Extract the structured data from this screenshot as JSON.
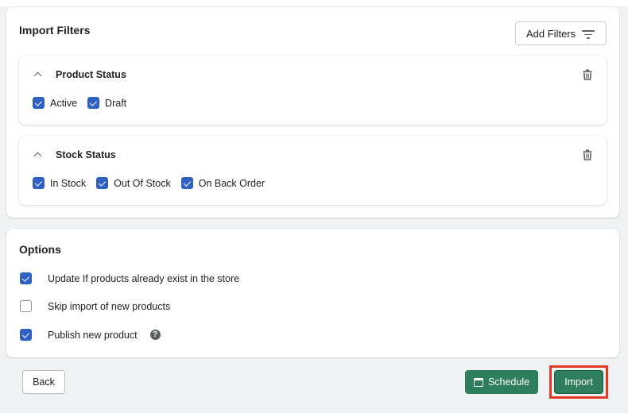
{
  "import_filters": {
    "title": "Import Filters",
    "add_filters_label": "Add Filters",
    "groups": [
      {
        "title": "Product Status",
        "expanded": true,
        "options": [
          {
            "label": "Active",
            "checked": true
          },
          {
            "label": "Draft",
            "checked": true
          }
        ]
      },
      {
        "title": "Stock Status",
        "expanded": true,
        "options": [
          {
            "label": "In Stock",
            "checked": true
          },
          {
            "label": "Out Of Stock",
            "checked": true
          },
          {
            "label": "On Back Order",
            "checked": true
          }
        ]
      }
    ]
  },
  "options": {
    "title": "Options",
    "items": [
      {
        "label": "Update If products already exist in the store",
        "checked": true
      },
      {
        "label": "Skip import of new products",
        "checked": false
      },
      {
        "label": "Publish new product",
        "checked": true,
        "help_icon": "?"
      }
    ]
  },
  "footer": {
    "back_label": "Back",
    "schedule_label": "Schedule",
    "import_label": "Import"
  },
  "colors": {
    "primary_green": "#2e7d5c",
    "checkbox_blue": "#3160c4",
    "highlight_red": "#e03a22"
  }
}
